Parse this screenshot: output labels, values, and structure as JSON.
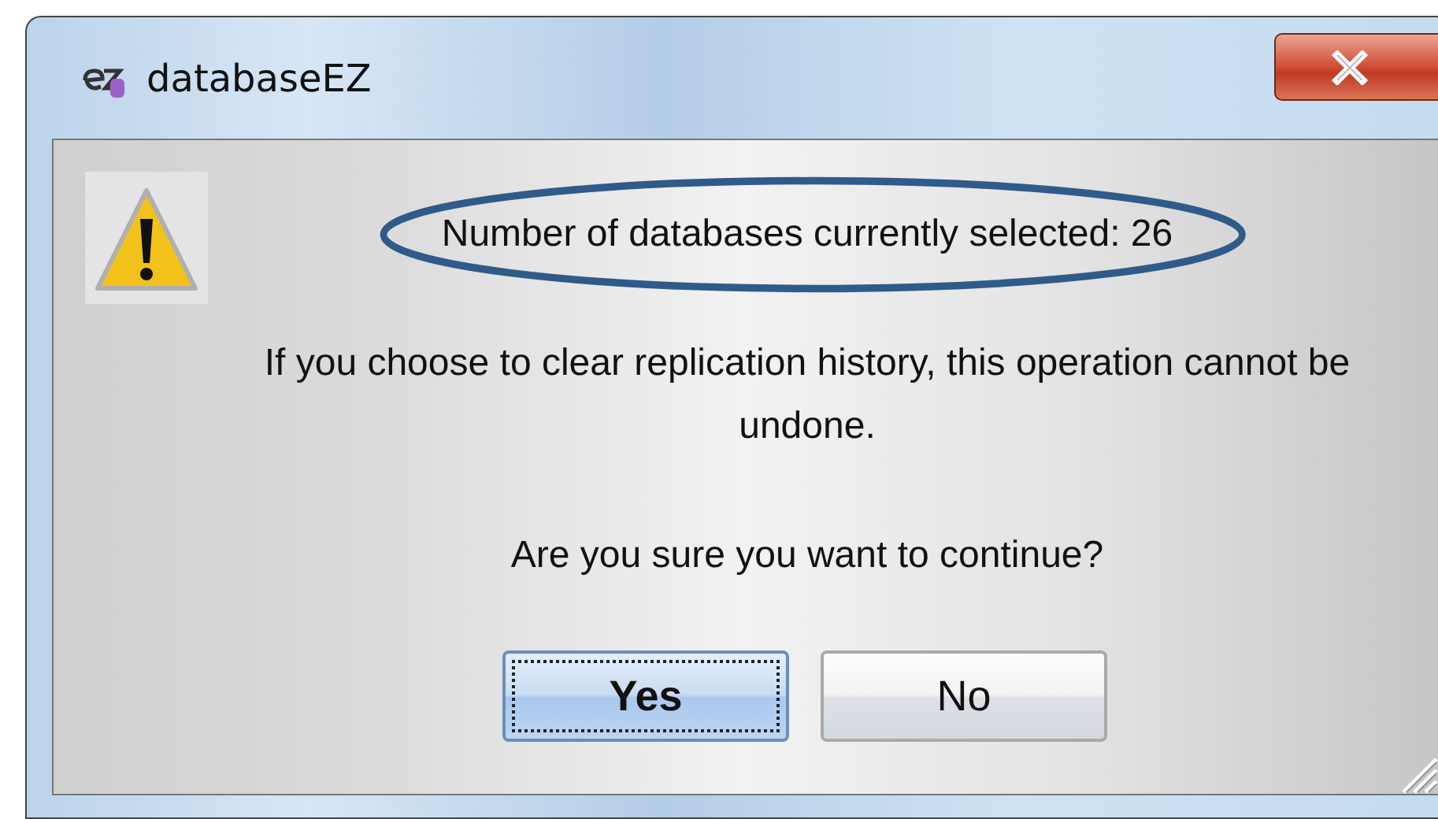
{
  "window": {
    "title": "databaseEZ"
  },
  "message": {
    "lines": [
      {
        "text": "Number of databases currently selected: 26",
        "highlighted": true
      },
      {
        "text": "If you choose to clear replication history, this operation cannot be undone.",
        "highlighted": false
      },
      {
        "text": "Are you sure you want to continue?",
        "highlighted": false
      }
    ]
  },
  "buttons": [
    {
      "label": "Yes",
      "focused": true
    },
    {
      "label": "No",
      "focused": false
    }
  ]
}
